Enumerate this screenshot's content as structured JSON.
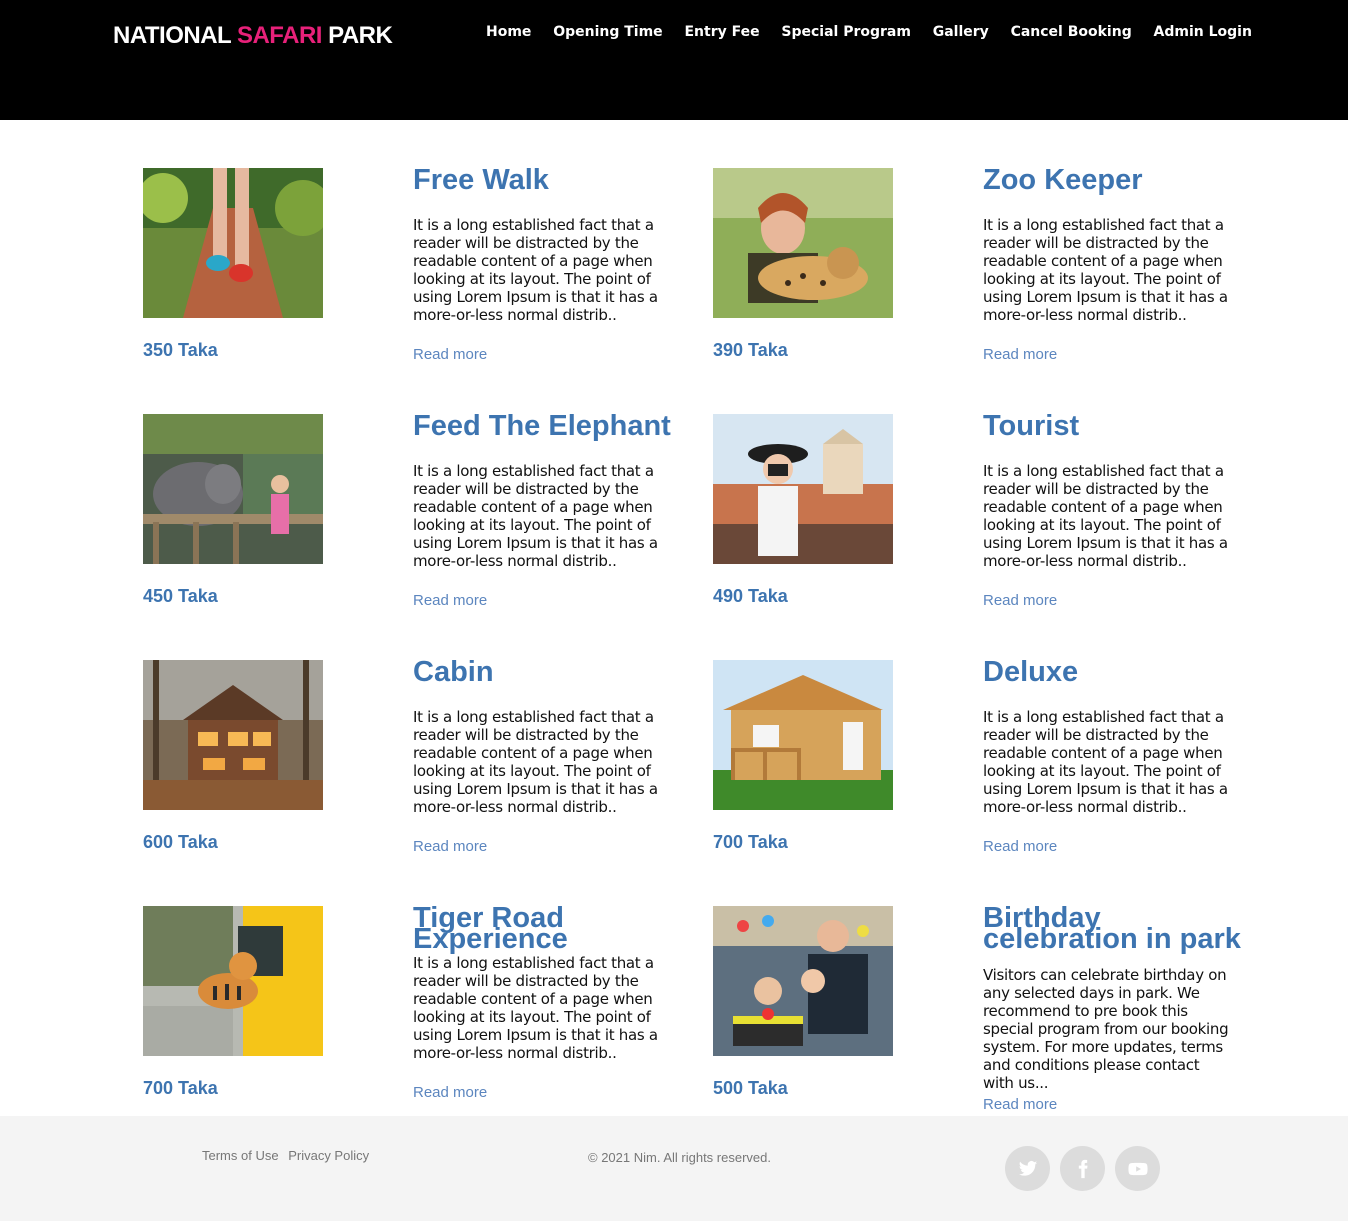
{
  "brand": {
    "part1": "NATIONAL ",
    "part2": "SAFARI",
    "part3": " PARK",
    "accent_color": "#e8217a"
  },
  "nav": [
    "Home",
    "Opening Time",
    "Entry Fee",
    "Special Program",
    "Gallery",
    "Cancel Booking",
    "Admin Login"
  ],
  "programs": [
    {
      "title": "Free Walk",
      "price": "350 Taka",
      "description": "It is a long established fact that a reader will be distracted by the readable content of a page when looking at its layout. The point of using Lorem Ipsum is that it has a more-or-less normal distrib..",
      "link": "Read more",
      "image": "jogging-trail-photo"
    },
    {
      "title": "Zoo Keeper",
      "price": "390 Taka",
      "description": "It is a long established fact that a reader will be distracted by the readable content of a page when looking at its layout. The point of using Lorem Ipsum is that it has a more-or-less normal distrib..",
      "link": "Read more",
      "image": "keeper-with-cheetah-photo"
    },
    {
      "title": "Feed The Elephant",
      "price": "450 Taka",
      "description": "It is a long established fact that a reader will be distracted by the readable content of a page when looking at its layout. The point of using Lorem Ipsum is that it has a more-or-less normal distrib..",
      "link": "Read more",
      "image": "elephant-feeding-photo"
    },
    {
      "title": "Tourist",
      "price": "490 Taka",
      "description": "It is a long established fact that a reader will be distracted by the readable content of a page when looking at its layout. The point of using Lorem Ipsum is that it has a more-or-less normal distrib..",
      "link": "Read more",
      "image": "tourist-camera-photo"
    },
    {
      "title": "Cabin",
      "price": "600 Taka",
      "description": "It is a long established fact that a reader will be distracted by the readable content of a page when looking at its layout. The point of using Lorem Ipsum is that it has a more-or-less normal distrib..",
      "link": "Read more",
      "image": "forest-cabin-photo"
    },
    {
      "title": "Deluxe",
      "price": "700 Taka",
      "description": "It is a long established fact that a reader will be distracted by the readable content of a page when looking at its layout. The point of using Lorem Ipsum is that it has a more-or-less normal distrib..",
      "link": "Read more",
      "image": "wooden-house-photo"
    },
    {
      "title": "Tiger Road Experience",
      "price": "700 Taka",
      "description": "It is a long established fact that a reader will be distracted by the readable content of a page when looking at its layout. The point of using Lorem Ipsum is that it has a more-or-less normal distrib..",
      "link": "Read more",
      "image": "tiger-bus-photo"
    },
    {
      "title": "Birthday celebration in park",
      "price": "500 Taka",
      "description": "Visitors can celebrate birthday on any selected days in park. We recommend to pre book this special program from our booking system. For more updates, terms and conditions please contact with us...",
      "link": "Read more",
      "image": "birthday-party-photo"
    }
  ],
  "footer": {
    "terms": "Terms of Use",
    "privacy": "Privacy Policy",
    "copyright": "© 2021 Nim. All rights reserved.",
    "social": [
      "twitter-icon",
      "facebook-icon",
      "youtube-icon"
    ]
  },
  "colors": {
    "header_bg": "#000000",
    "link_blue": "#3d74b0",
    "footer_bg": "#f4f4f4"
  }
}
